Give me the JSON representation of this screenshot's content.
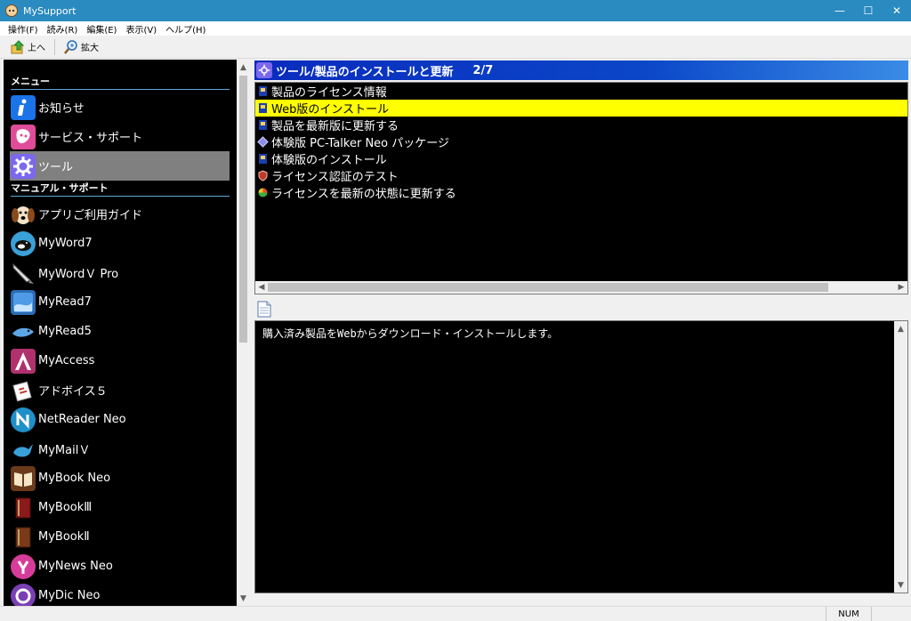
{
  "window": {
    "title": "MySupport",
    "minimize": "—",
    "maximize": "☐",
    "close": "✕"
  },
  "menu": [
    "操作(F)",
    "読み(R)",
    "編集(E)",
    "表示(V)",
    "ヘルプ(H)"
  ],
  "toolbar": {
    "up_label": "上へ",
    "zoom_label": "拡大"
  },
  "sidebar": {
    "sections": [
      {
        "title": "メニュー",
        "items": [
          {
            "label": "お知らせ",
            "icon": "info-icon"
          },
          {
            "label": "サービス・サポート",
            "icon": "support-icon"
          },
          {
            "label": "ツール",
            "icon": "gear-icon",
            "selected": true
          }
        ]
      },
      {
        "title": "マニュアル・サポート",
        "items": [
          {
            "label": "アプリご利用ガイド",
            "icon": "beagle-icon"
          },
          {
            "label": "MyWord7",
            "icon": "myword7-icon"
          },
          {
            "label": "MyWordＶ Pro",
            "icon": "mywordv-pro-icon"
          },
          {
            "label": "MyRead7",
            "icon": "myread7-icon"
          },
          {
            "label": "MyRead5",
            "icon": "myread5-icon"
          },
          {
            "label": "MyAccess",
            "icon": "myaccess-icon"
          },
          {
            "label": "アドボイス５",
            "icon": "advoice5-icon"
          },
          {
            "label": "NetReader Neo",
            "icon": "netreader-neo-icon"
          },
          {
            "label": "MyMailＶ",
            "icon": "mymail-v-icon"
          },
          {
            "label": "MyBook Neo",
            "icon": "mybook-neo-icon"
          },
          {
            "label": "MyBookⅢ",
            "icon": "mybook3-icon"
          },
          {
            "label": "MyBookⅡ",
            "icon": "mybook2-icon"
          },
          {
            "label": "MyNews Neo",
            "icon": "mynews-neo-icon"
          },
          {
            "label": "MyDic Neo",
            "icon": "mydic-neo-icon"
          }
        ]
      }
    ]
  },
  "header": {
    "title": "ツール/製品のインストールと更新",
    "count": "2/7"
  },
  "list": [
    {
      "label": "製品のライセンス情報",
      "icon": "installer-icon"
    },
    {
      "label": "Web版のインストール",
      "icon": "installer-icon",
      "selected": true
    },
    {
      "label": "製品を最新版に更新する",
      "icon": "installer-icon"
    },
    {
      "label": "体験版 PC-Talker Neo パッケージ",
      "icon": "package-icon"
    },
    {
      "label": "体験版のインストール",
      "icon": "installer-icon"
    },
    {
      "label": "ライセンス認証のテスト",
      "icon": "shield-icon"
    },
    {
      "label": "ライセンスを最新の状態に更新する",
      "icon": "refresh-icon"
    }
  ],
  "description": "購入済み製品をWebからダウンロード・インストールします。",
  "status": {
    "num": "NUM"
  },
  "colors": {
    "selected_bg": "#ffff00",
    "header_bg": "#0a2bbd",
    "titlebar_bg": "#2a8bc0",
    "sidebar_selected": "#808080"
  }
}
